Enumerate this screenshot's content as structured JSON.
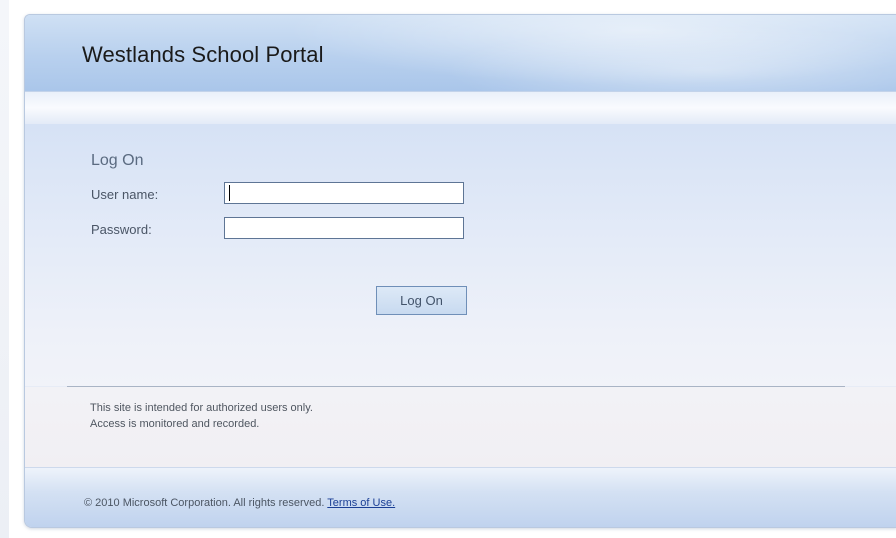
{
  "header": {
    "title": "Westlands School Portal"
  },
  "login": {
    "heading": "Log On",
    "username_label": "User name:",
    "username_value": "",
    "password_label": "Password:",
    "password_value": "",
    "submit_label": "Log On"
  },
  "notice": {
    "line1": "This site is intended for authorized users only.",
    "line2": "Access is monitored and recorded."
  },
  "footer": {
    "copyright": "© 2010 Microsoft Corporation. All rights reserved.",
    "terms_link": "Terms of Use."
  },
  "colors": {
    "header_blue": "#b8d0ee",
    "link_blue": "#1b3f95",
    "button_border": "#6f8fb8"
  }
}
